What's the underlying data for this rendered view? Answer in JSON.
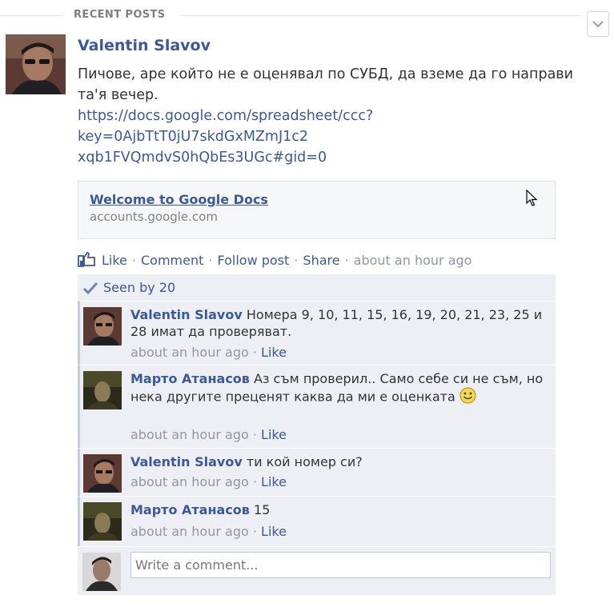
{
  "section": {
    "title": "RECENT POSTS"
  },
  "post": {
    "author": "Valentin Slavov",
    "message": "Пичове, аре който не е оценявал по СУБД, да вземе да го направи та'я вечер.",
    "link_text": "https://docs.google.com/spreadsheet/ccc?key=0AjbTtT0jU7skdGxMZmJ1c2xqb1FVQmdvS0hQbEs3UGc#gid=0",
    "link_lines": [
      "https://docs.google.com/spreadsheet/ccc?",
      "key=0AjbTtT0jU7skdGxMZmJ1c2",
      "xqb1FVQmdvS0hQbEs3UGc#gid=0"
    ],
    "preview": {
      "title": "Welcome to Google Docs",
      "domain": "accounts.google.com"
    },
    "actions": {
      "like": "Like",
      "comment": "Comment",
      "follow": "Follow post",
      "share": "Share",
      "time": "about an hour ago"
    },
    "seen_by": "Seen by 20"
  },
  "comments": [
    {
      "author": "Valentin Slavov",
      "text": "Номера 9, 10, 11, 15, 16, 19, 20, 21, 23, 25 и 28 имат да проверяват.",
      "time": "about an hour ago",
      "like": "Like"
    },
    {
      "author": "Марто Атанасов",
      "text": "Аз съм проверил.. Само себе си не съм, но нека другите преценят каква да ми е оценката",
      "time": "about an hour ago",
      "like": "Like"
    },
    {
      "author": "Valentin Slavov",
      "text": "ти кой номер си?",
      "time": "about an hour ago",
      "like": "Like"
    },
    {
      "author": "Марто Атанасов",
      "text": "15",
      "time": "about an hour ago",
      "like": "Like"
    }
  ],
  "composer": {
    "placeholder": "Write a comment..."
  },
  "colors": {
    "link": "#3b5998",
    "muted": "#9197a3",
    "ufi_bg": "#edeff4"
  }
}
